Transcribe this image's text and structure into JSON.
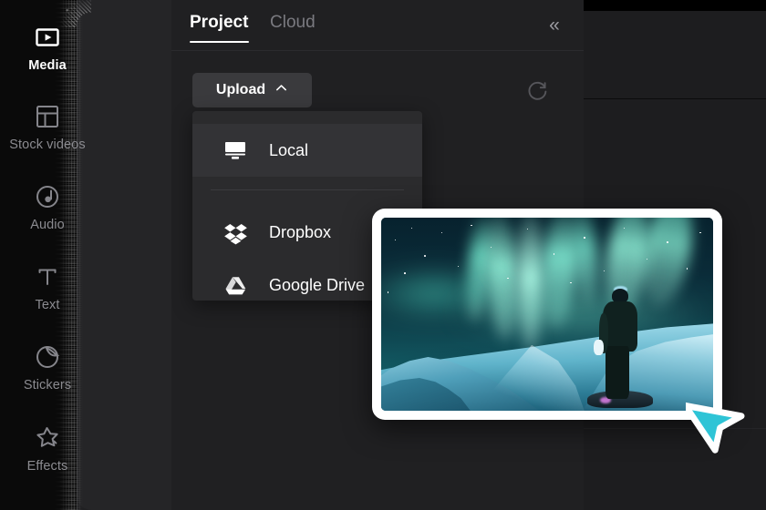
{
  "app": {
    "accent_cyan": "#2ec4d6",
    "panel_bg": "#202022",
    "sidebar_bg": "#252527",
    "dropdown_bg": "#2b2b2d"
  },
  "sidebar": {
    "items": [
      {
        "label": "Media",
        "icon": "media-play-rect-icon",
        "active": true
      },
      {
        "label": "Stock videos",
        "icon": "layout-grid-icon",
        "active": false
      },
      {
        "label": "Audio",
        "icon": "music-note-circle-icon",
        "active": false
      },
      {
        "label": "Text",
        "icon": "text-t-icon",
        "active": false
      },
      {
        "label": "Stickers",
        "icon": "sticker-peel-icon",
        "active": false
      },
      {
        "label": "Effects",
        "icon": "sparkle-star-icon",
        "active": false
      }
    ]
  },
  "tabs": {
    "items": [
      {
        "label": "Project",
        "active": true
      },
      {
        "label": "Cloud",
        "active": false
      }
    ],
    "collapse_icon": "«",
    "collapse_icon_name": "collapse-panel-icon"
  },
  "toolbar": {
    "upload_label": "Upload",
    "upload_caret": "⌃",
    "refresh_icon_name": "refresh-icon"
  },
  "upload_menu": {
    "items": [
      {
        "label": "Local",
        "icon": "monitor-icon",
        "hover": true
      },
      {
        "label": "Dropbox",
        "icon": "dropbox-icon",
        "hover": false
      },
      {
        "label": "Google Drive",
        "icon": "google-drive-icon",
        "hover": false
      }
    ]
  },
  "thumbnail": {
    "alt": "aurora-borealis-night-sky-over-snowy-mountain-with-person",
    "name": "media-thumbnail-card"
  },
  "cursor": {
    "name": "mouse-pointer",
    "fill": "#2ec4d6",
    "stroke": "#ffffff"
  }
}
